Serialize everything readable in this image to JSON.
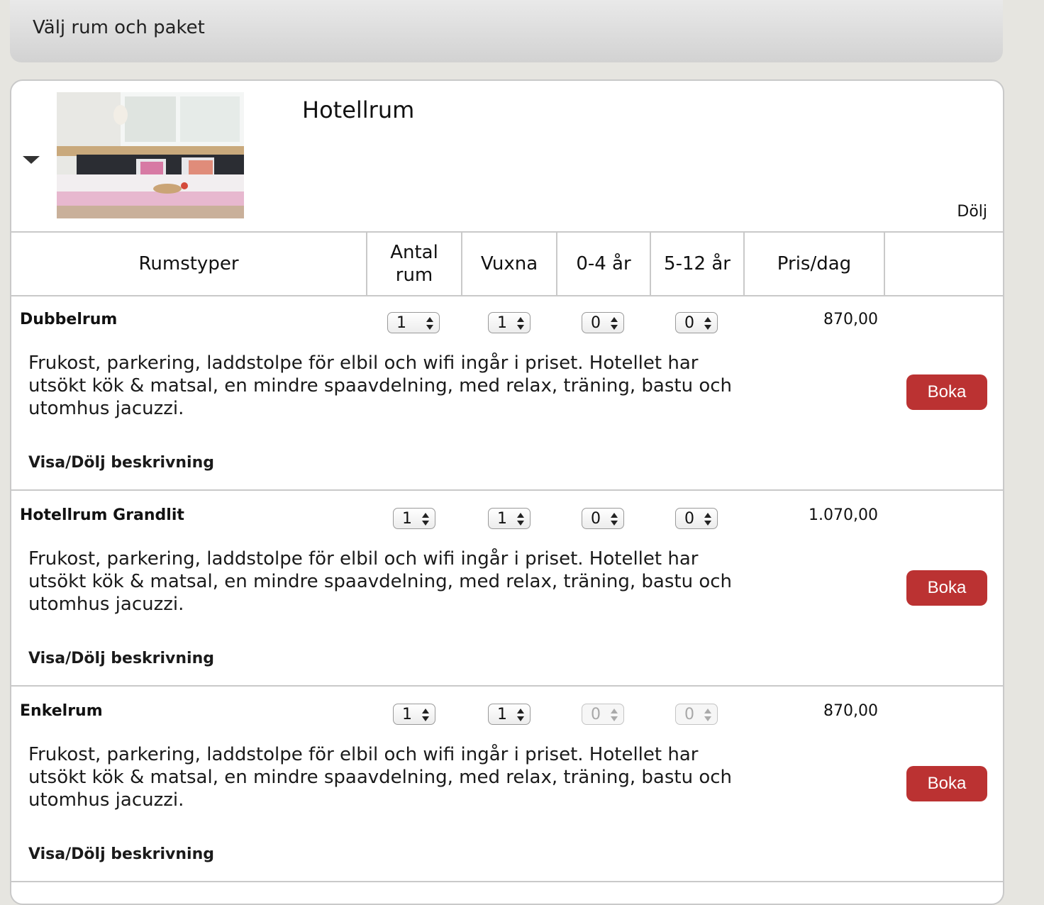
{
  "header": {
    "title": "Välj rum och paket"
  },
  "package": {
    "title": "Hotellrum",
    "hide_label": "Dölj"
  },
  "table": {
    "columns": {
      "room_types": "Rumstyper",
      "num_rooms_1": "Antal",
      "num_rooms_2": "rum",
      "adults": "Vuxna",
      "age_0_4": "0-4 år",
      "age_5_12": "5-12 år",
      "price_per_day": "Pris/dag"
    }
  },
  "rooms": [
    {
      "name": "Dubbelrum",
      "num_rooms": "1",
      "adults": "1",
      "age_0_4": "0",
      "age_5_12": "0",
      "price": "870,00",
      "description": "Frukost, parkering, laddstolpe för elbil och wifi ingår i priset. Hotellet har utsökt kök & matsal, en mindre spaavdelning, med relax, träning, bastu och utomhus jacuzzi.",
      "book_label": "Boka",
      "toggle_label": "Visa/Dölj beskrivning"
    },
    {
      "name": "Hotellrum Grandlit",
      "num_rooms": "1",
      "adults": "1",
      "age_0_4": "0",
      "age_5_12": "0",
      "price": "1.070,00",
      "description": "Frukost, parkering, laddstolpe för elbil och wifi ingår i priset. Hotellet har utsökt kök & matsal, en mindre spaavdelning, med relax, träning, bastu och utomhus jacuzzi.",
      "book_label": "Boka",
      "toggle_label": "Visa/Dölj beskrivning"
    },
    {
      "name": "Enkelrum",
      "num_rooms": "1",
      "adults": "1",
      "age_0_4": "0",
      "age_5_12": "0",
      "price": "870,00",
      "description": "Frukost, parkering, laddstolpe för elbil och wifi ingår i priset. Hotellet har utsökt kök & matsal, en mindre spaavdelning, med relax, träning, bastu och utomhus jacuzzi.",
      "book_label": "Boka",
      "toggle_label": "Visa/Dölj beskrivning"
    }
  ],
  "colors": {
    "book_button": "#bb3232",
    "background": "#e6e5e0"
  }
}
